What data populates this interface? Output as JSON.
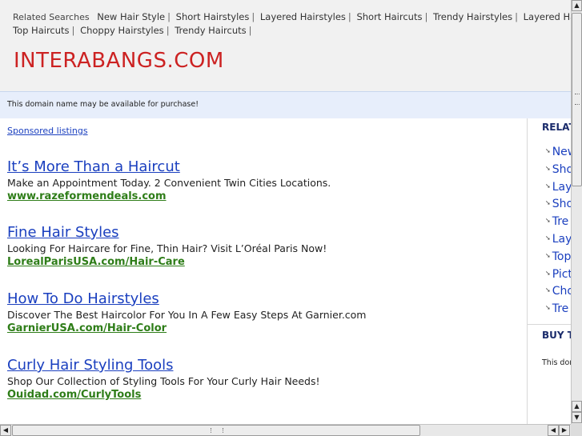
{
  "header": {
    "related_label": "Related Searches",
    "related_links": [
      "New Hair Style",
      "Short Hairstyles",
      "Layered Hairstyles",
      "Short Haircuts",
      "Trendy Hairstyles",
      "Layered Haircuts",
      "Top Haircuts",
      "Choppy Hairstyles",
      "Trendy Haircuts"
    ],
    "site_name": "INTERABANGS.COM"
  },
  "notice": "This domain name may be available for purchase!",
  "sponsored_label": "Sponsored listings",
  "ads": [
    {
      "title": "It’s More Than a Haircut",
      "desc": "Make an Appointment Today. 2 Convenient Twin Cities Locations.",
      "url": "www.razeformendeals.com"
    },
    {
      "title": "Fine Hair Styles",
      "desc": "Looking For Haircare for Fine, Thin Hair? Visit L’Oréal Paris Now!",
      "url": "LorealParisUSA.com/Hair-Care"
    },
    {
      "title": "How To Do Hairstyles",
      "desc": "Discover The Best Haircolor For You In A Few Easy Steps At Garnier.com",
      "url": "GarnierUSA.com/Hair-Color"
    },
    {
      "title": "Curly Hair Styling Tools",
      "desc": "Shop Our Collection of Styling Tools For Your Curly Hair Needs!",
      "url": "Ouidad.com/CurlyTools"
    }
  ],
  "right_col": {
    "heading": "RELAT",
    "items": [
      "New",
      "Sho",
      "Lay",
      "Sho",
      "Tre",
      "Lay",
      "Top",
      "Pict",
      "Cho",
      "Tre"
    ],
    "buy_heading": "BUY T",
    "buy_note": "This dom"
  },
  "scrollbars": {
    "up_glyph": "▲",
    "down_glyph": "▼",
    "left_glyph": "◀",
    "right_glyph": "▶"
  }
}
